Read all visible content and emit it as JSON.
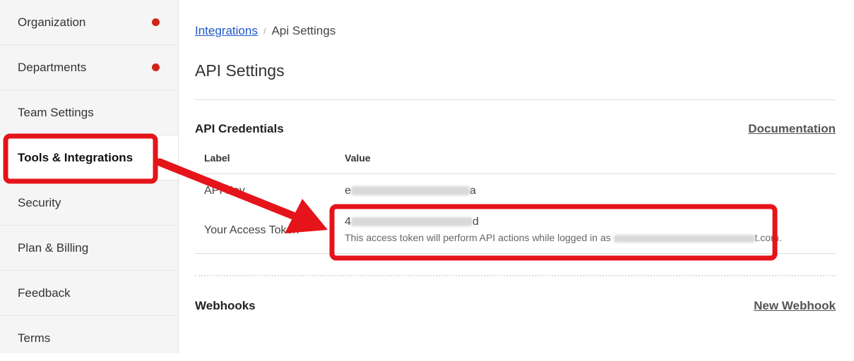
{
  "sidebar": {
    "items": [
      {
        "label": "Organization",
        "dot": true
      },
      {
        "label": "Departments",
        "dot": true
      },
      {
        "label": "Team Settings",
        "dot": false
      },
      {
        "label": "Tools & Integrations",
        "active": true
      },
      {
        "label": "Security"
      },
      {
        "label": "Plan & Billing"
      },
      {
        "label": "Feedback"
      },
      {
        "label": "Terms"
      }
    ]
  },
  "breadcrumb": {
    "link": "Integrations",
    "current": "Api Settings"
  },
  "page": {
    "title": "API Settings"
  },
  "credentials": {
    "title": "API Credentials",
    "doc_link": "Documentation",
    "columns": {
      "label": "Label",
      "value": "Value"
    },
    "rows": [
      {
        "label": "API Key",
        "value_start": "e",
        "value_end": "a"
      },
      {
        "label": "Your Access Token",
        "value_start": "4",
        "value_end": "d",
        "note_start": "This access token will perform API actions while logged in as",
        "note_end": "t.com."
      }
    ]
  },
  "webhooks": {
    "title": "Webhooks",
    "new_link": "New Webhook"
  },
  "colors": {
    "accent_red": "#e5141a",
    "link_blue": "#1e56c7",
    "notification_dot": "#d0241b"
  }
}
